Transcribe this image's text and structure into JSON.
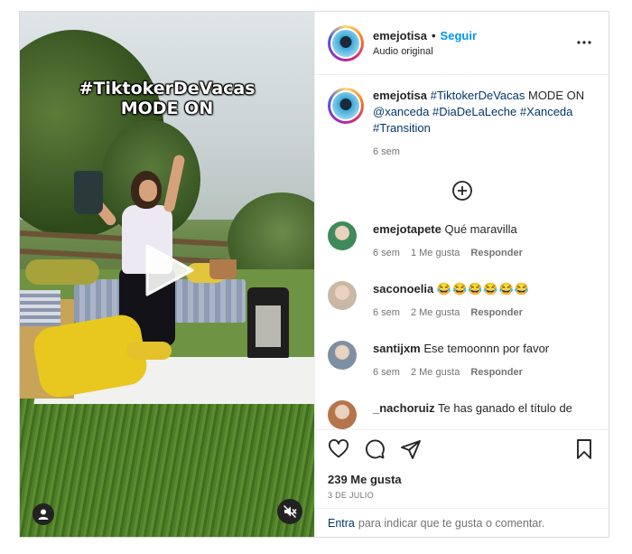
{
  "video": {
    "overlay_line1": "#TiktokerDeVacas",
    "overlay_line2": "MODE ON",
    "play_icon": "play-icon",
    "user_icon": "user-icon",
    "mute_icon": "muted-speaker-icon"
  },
  "header": {
    "username": "emejotisa",
    "separator": "•",
    "follow_label": "Seguir",
    "subtitle": "Audio original",
    "more_icon": "more-options-icon",
    "more_label": "•••"
  },
  "caption": {
    "username": "emejotisa",
    "text_parts": [
      {
        "text": "#TiktokerDeVacas",
        "tag": true
      },
      {
        "text": " MODE ON ",
        "tag": false
      },
      {
        "text": "@xanceda",
        "tag": true
      },
      {
        "text": " ",
        "tag": false
      },
      {
        "text": "#DiaDeLaLeche",
        "tag": true
      },
      {
        "text": " ",
        "tag": false
      },
      {
        "text": "#Xanceda",
        "tag": true
      },
      {
        "text": " ",
        "tag": false
      },
      {
        "text": "#Transition",
        "tag": true
      }
    ],
    "time": "6 sem",
    "add_icon": "add-circle-icon"
  },
  "comments": [
    {
      "username": "emejotapete",
      "text": "Qué maravilla",
      "time": "6 sem",
      "likes": "1 Me gusta",
      "reply": "Responder",
      "avatar_color": "#3f8a5a"
    },
    {
      "username": "saconoelia",
      "text": "😂😂😂😂😂😂",
      "time": "6 sem",
      "likes": "2 Me gusta",
      "reply": "Responder",
      "avatar_color": "#c9b8a4"
    },
    {
      "username": "santijxm",
      "text": "Ese temoonnn por favor",
      "time": "6 sem",
      "likes": "2 Me gusta",
      "reply": "Responder",
      "avatar_color": "#7d8fa3"
    },
    {
      "username": "_nachoruiz",
      "text": "Te has ganado el título de",
      "time": "",
      "likes": "",
      "reply": "",
      "avatar_color": "#b5744a"
    }
  ],
  "actions": {
    "like_icon": "heart-icon",
    "comment_icon": "comment-icon",
    "share_icon": "share-icon",
    "save_icon": "bookmark-icon"
  },
  "likes": "239 Me gusta",
  "date": "3 DE JULIO",
  "footer": {
    "login_link": "Entra",
    "text": "para indicar que te gusta o comentar."
  },
  "colors": {
    "accent": "#0095f6",
    "link": "#00376b",
    "muted": "#737373",
    "border": "#dbdbdb"
  }
}
